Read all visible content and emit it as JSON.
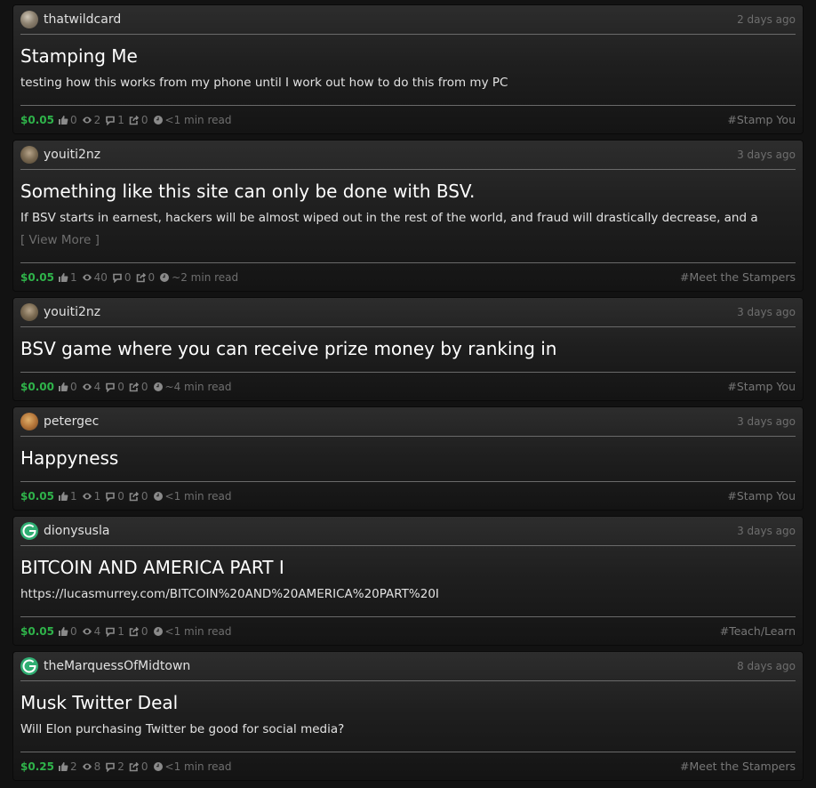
{
  "posts": [
    {
      "author": "thatwildcard",
      "avatar": "grain-avatar",
      "time": "2 days ago",
      "title": "Stamping Me",
      "excerpt": "testing how this works from my phone until I work out how to do this from my PC",
      "more": "",
      "amount": "$0.05",
      "likes": "0",
      "views": "2",
      "comments": "1",
      "shares": "0",
      "read": "<1 min read",
      "tag": "#Stamp You"
    },
    {
      "author": "youiti2nz",
      "avatar": "rock-avatar",
      "time": "3 days ago",
      "title": "Something like this site can only be done with BSV.",
      "excerpt": "If BSV starts in earnest, hackers will be almost wiped out in the rest of the world, and fraud will drastically decrease, and a",
      "more": "[ View More ]",
      "amount": "$0.05",
      "likes": "1",
      "views": "40",
      "comments": "0",
      "shares": "0",
      "read": "~2 min read",
      "tag": "#Meet the Stampers"
    },
    {
      "author": "youiti2nz",
      "avatar": "rock-avatar",
      "time": "3 days ago",
      "title": "BSV game where you can receive prize money by ranking in",
      "excerpt": "",
      "more": "",
      "amount": "$0.00",
      "likes": "0",
      "views": "4",
      "comments": "0",
      "shares": "0",
      "read": "~4 min read",
      "tag": "#Stamp You"
    },
    {
      "author": "petergec",
      "avatar": "food-avatar",
      "time": "3 days ago",
      "title": "Happyness",
      "excerpt": "",
      "more": "",
      "amount": "$0.05",
      "likes": "1",
      "views": "1",
      "comments": "0",
      "shares": "0",
      "read": "<1 min read",
      "tag": "#Stamp You"
    },
    {
      "author": "dionysusla",
      "avatar": "g-logo-avatar",
      "time": "3 days ago",
      "title": "BITCOIN AND AMERICA PART I",
      "excerpt": "https://lucasmurrey.com/BITCOIN%20AND%20AMERICA%20PART%20I",
      "more": "",
      "amount": "$0.05",
      "likes": "0",
      "views": "4",
      "comments": "1",
      "shares": "0",
      "read": "<1 min read",
      "tag": "#Teach/Learn"
    },
    {
      "author": "theMarquessOfMidtown",
      "avatar": "g-logo-avatar",
      "time": "8 days ago",
      "title": "Musk Twitter Deal",
      "excerpt": "Will Elon purchasing Twitter be good for social media?",
      "more": "",
      "amount": "$0.25",
      "likes": "2",
      "views": "8",
      "comments": "2",
      "shares": "0",
      "read": "<1 min read",
      "tag": "#Meet the Stampers"
    }
  ],
  "icons": {
    "like": "thumbs-up-icon",
    "view": "eye-icon",
    "comment": "comment-icon",
    "share": "share-icon",
    "read": "clock-icon"
  },
  "colors": {
    "amount": "#2fb34a",
    "background": "#121212"
  }
}
